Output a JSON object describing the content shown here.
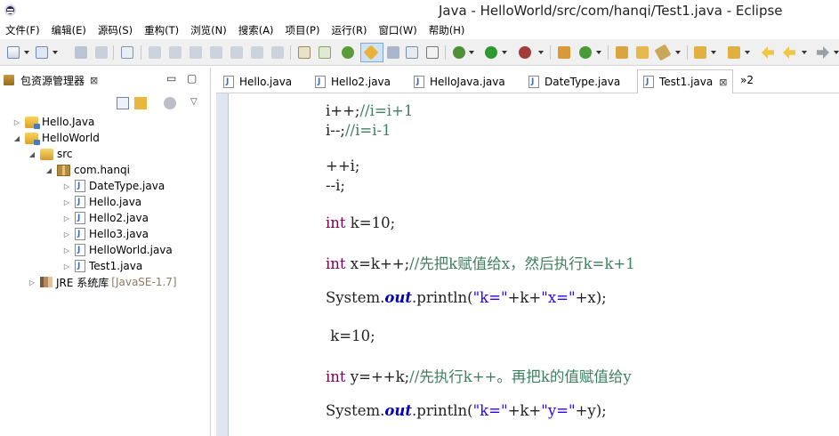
{
  "window": {
    "title": "Java - HelloWorld/src/com/hanqi/Test1.java - Eclipse"
  },
  "menu": [
    {
      "label": "文件(F)"
    },
    {
      "label": "编辑(E)"
    },
    {
      "label": "源码(S)"
    },
    {
      "label": "重构(T)"
    },
    {
      "label": "浏览(N)"
    },
    {
      "label": "搜索(A)"
    },
    {
      "label": "项目(P)"
    },
    {
      "label": "运行(R)"
    },
    {
      "label": "窗口(W)"
    },
    {
      "label": "帮助(H)"
    }
  ],
  "package_explorer": {
    "title": "包资源管理器",
    "close_glyph": "⊠",
    "tree": [
      {
        "label": "Hello.Java",
        "kind": "project",
        "twisty": "▷"
      },
      {
        "label": "HelloWorld",
        "kind": "project",
        "twisty": "◢"
      },
      {
        "label": "src",
        "kind": "src",
        "twisty": "◢"
      },
      {
        "label": "com.hanqi",
        "kind": "pkg",
        "twisty": "◢"
      },
      {
        "label": "DateType.java",
        "kind": "java",
        "twisty": "▷"
      },
      {
        "label": "Hello.java",
        "kind": "java",
        "twisty": "▷"
      },
      {
        "label": "Hello2.java",
        "kind": "java",
        "twisty": "▷"
      },
      {
        "label": "Hello3.java",
        "kind": "java",
        "twisty": "▷"
      },
      {
        "label": "HelloWorld.java",
        "kind": "java",
        "twisty": "▷"
      },
      {
        "label": "Test1.java",
        "kind": "java",
        "twisty": "▷"
      },
      {
        "label": "JRE 系统库",
        "kind": "lib",
        "twisty": "▷",
        "suffix": "[JavaSE-1.7]"
      }
    ]
  },
  "editor": {
    "tabs": [
      {
        "label": "Hello.java",
        "active": false
      },
      {
        "label": "Hello2.java",
        "active": false
      },
      {
        "label": "HelloJava.java",
        "active": false
      },
      {
        "label": "DateType.java",
        "active": false
      },
      {
        "label": "Test1.java",
        "active": true
      }
    ],
    "active_close_glyph": "⊠",
    "overflow_label": "»2",
    "code_lines": [
      [
        {
          "t": "i++;",
          "c": "pl"
        },
        {
          "t": "//i=i+1",
          "c": "cm"
        }
      ],
      [
        {
          "t": "i--;",
          "c": "pl"
        },
        {
          "t": "//i=i-1",
          "c": "cm"
        }
      ],
      [
        {
          "t": "++i;",
          "c": "pl"
        }
      ],
      [
        {
          "t": "--i;",
          "c": "pl"
        }
      ],
      [
        {
          "t": "int",
          "c": "kw"
        },
        {
          "t": " k=10;",
          "c": "pl"
        }
      ],
      [
        {
          "t": "int",
          "c": "kw"
        },
        {
          "t": " x=k++;",
          "c": "pl"
        },
        {
          "t": "//先把k赋值给x，然后执行k=k+1",
          "c": "cm"
        }
      ],
      [
        {
          "t": "System.",
          "c": "pl"
        },
        {
          "t": "out",
          "c": "static"
        },
        {
          "t": ".println(",
          "c": "pl"
        },
        {
          "t": "\"k=\"",
          "c": "str"
        },
        {
          "t": "+k+",
          "c": "pl"
        },
        {
          "t": "\"x=\"",
          "c": "str"
        },
        {
          "t": "+x);",
          "c": "pl"
        }
      ],
      [
        {
          "t": " k=10;",
          "c": "pl"
        }
      ],
      [
        {
          "t": "int",
          "c": "kw"
        },
        {
          "t": " y=++k;",
          "c": "pl"
        },
        {
          "t": "//先执行k++。再把k的值赋值给y",
          "c": "cm"
        }
      ],
      [
        {
          "t": "System.",
          "c": "pl"
        },
        {
          "t": "out",
          "c": "static"
        },
        {
          "t": ".println(",
          "c": "pl"
        },
        {
          "t": "\"k=\"",
          "c": "str"
        },
        {
          "t": "+k+",
          "c": "pl"
        },
        {
          "t": "\"y=\"",
          "c": "str"
        },
        {
          "t": "+y);",
          "c": "pl"
        }
      ]
    ]
  },
  "colors": {
    "keyword": "#7f0055",
    "comment": "#3f7f5f",
    "string": "#2a00ff",
    "static_field": "#0000c0",
    "selected_tool": "#cfe2f6"
  }
}
